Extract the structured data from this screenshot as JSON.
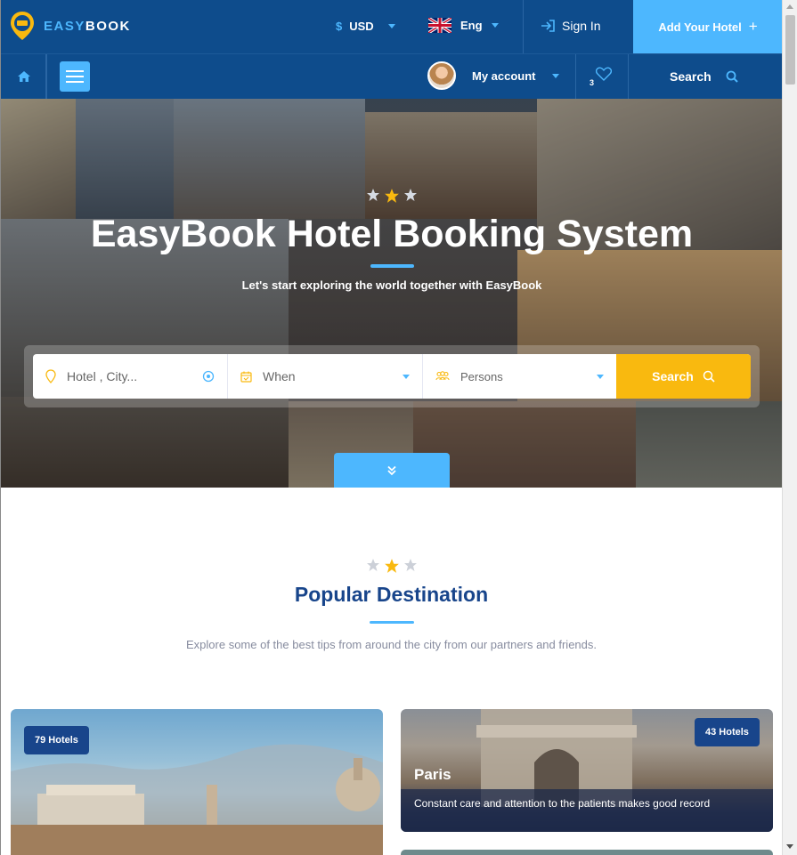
{
  "header": {
    "logo_text_1": "EASY",
    "logo_text_2": "BOOK",
    "currency_symbol": "$",
    "currency": "USD",
    "language": "Eng",
    "sign_in": "Sign In",
    "add_hotel": "Add Your Hotel",
    "add_hotel_icon": "+"
  },
  "nav": {
    "account_label": "My account",
    "wishlist_count": "3",
    "search_label": "Search"
  },
  "hero": {
    "title": "EasyBook Hotel Booking System",
    "subtitle": "Let's start exploring the world together with EasyBook",
    "search": {
      "location_placeholder": "Hotel , City...",
      "when_placeholder": "When",
      "persons_placeholder": "Persons",
      "button_label": "Search"
    }
  },
  "section": {
    "title": "Popular Destination",
    "subtitle": "Explore some of the best tips from around the city from our partners and friends."
  },
  "cards": [
    {
      "badge": "79 Hotels",
      "title": "",
      "text": ""
    },
    {
      "badge": "43 Hotels",
      "title": "Paris",
      "text": "Constant care and attention to the patients makes good record"
    }
  ],
  "colors": {
    "primary": "#0e4c8c",
    "accent": "#4db7fe",
    "cta": "#f9b90f",
    "heading": "#18458b"
  }
}
